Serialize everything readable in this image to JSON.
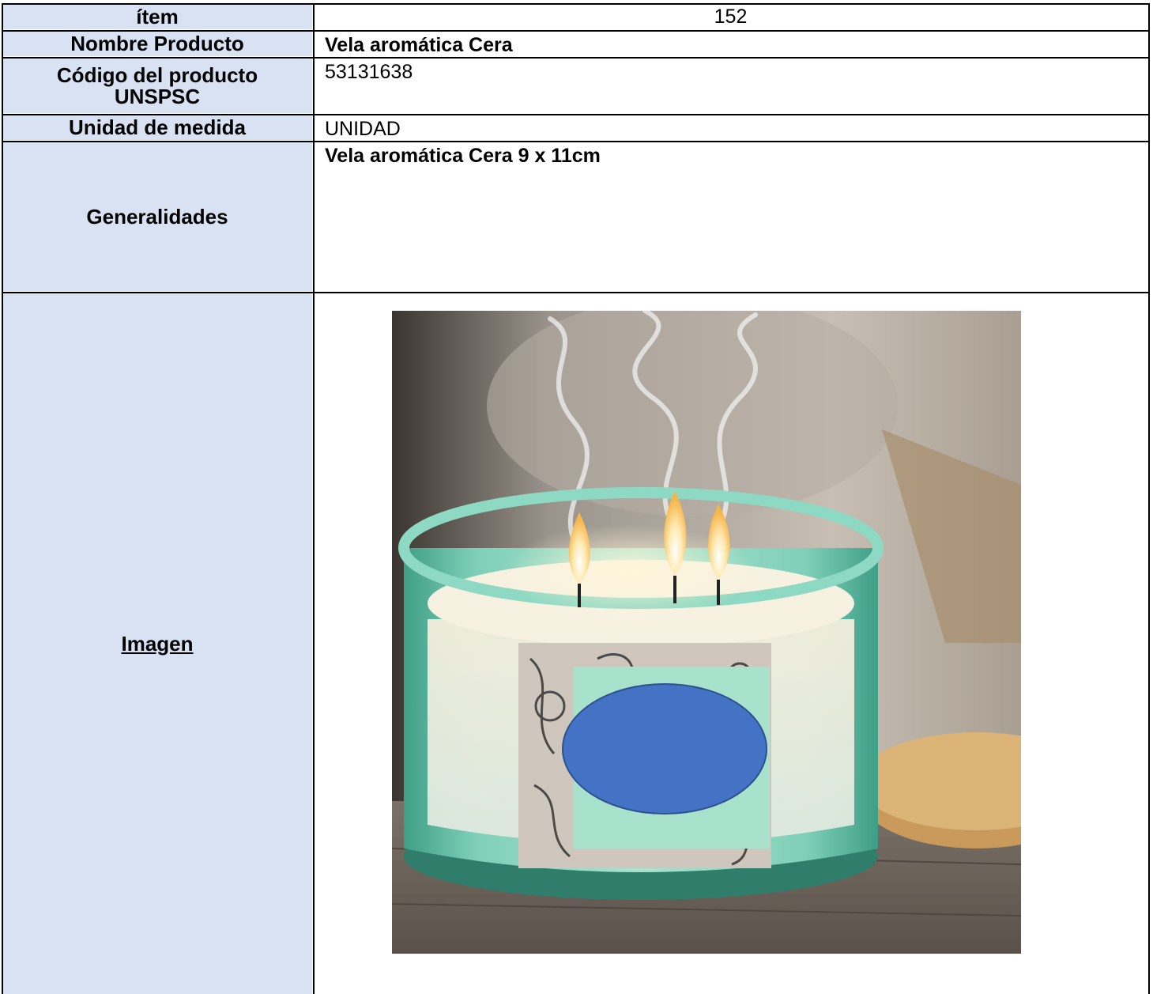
{
  "rows": {
    "item": {
      "label": "ítem",
      "value": "152"
    },
    "nombre": {
      "label": "Nombre Producto",
      "value": "Vela aromática  Cera"
    },
    "codigo": {
      "label_line1": "Código del producto",
      "label_line2": "UNSPSC",
      "value": "53131638"
    },
    "unidad": {
      "label": "Unidad de medida",
      "value": "UNIDAD"
    },
    "generalidades": {
      "label": "Generalidades",
      "value": "Vela aromática  Cera 9 x 11cm"
    },
    "imagen": {
      "label": "Imagen"
    }
  },
  "colors": {
    "label_bg": "#d9e2f3",
    "redaction_oval": "#4472c4",
    "glass": "#7fcfb8"
  }
}
